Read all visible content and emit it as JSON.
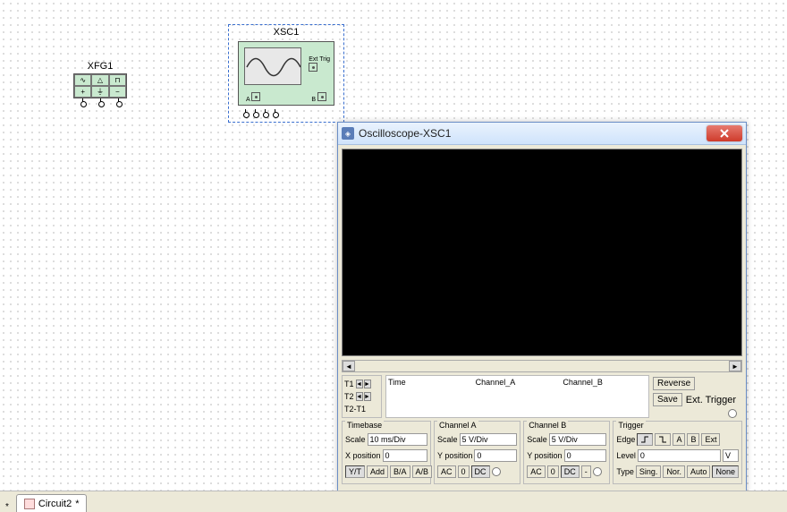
{
  "canvas": {
    "xfg": {
      "label": "XFG1"
    },
    "xsc": {
      "label": "XSC1",
      "ext_trig": "Ext Trig",
      "port_a": "A",
      "port_b": "B"
    }
  },
  "owin": {
    "title": "Oscilloscope-XSC1",
    "cursors": {
      "t1": "T1",
      "t2": "T2",
      "diff": "T2-T1"
    },
    "cols": {
      "time": "Time",
      "cha": "Channel_A",
      "chb": "Channel_B"
    },
    "buttons": {
      "reverse": "Reverse",
      "save": "Save",
      "ext_trigger": "Ext. Trigger"
    },
    "timebase": {
      "title": "Timebase",
      "scale_label": "Scale",
      "scale_value": "10 ms/Div",
      "xpos_label": "X position",
      "xpos_value": "0",
      "btn_yt": "Y/T",
      "btn_add": "Add",
      "btn_ba": "B/A",
      "btn_ab": "A/B"
    },
    "channel_a": {
      "title": "Channel A",
      "scale_label": "Scale",
      "scale_value": "5 V/Div",
      "ypos_label": "Y position",
      "ypos_value": "0",
      "btn_ac": "AC",
      "btn_0": "0",
      "btn_dc": "DC"
    },
    "channel_b": {
      "title": "Channel B",
      "scale_label": "Scale",
      "scale_value": "5 V/Div",
      "ypos_label": "Y position",
      "ypos_value": "0",
      "btn_ac": "AC",
      "btn_0": "0",
      "btn_dc": "DC",
      "btn_minus": "-"
    },
    "trigger": {
      "title": "Trigger",
      "edge_label": "Edge",
      "btn_a": "A",
      "btn_b": "B",
      "btn_ext": "Ext",
      "level_label": "Level",
      "level_value": "0",
      "level_unit": "V",
      "type_label": "Type",
      "btn_sing": "Sing.",
      "btn_nor": "Nor.",
      "btn_auto": "Auto",
      "btn_none": "None"
    }
  },
  "footer": {
    "tab_label": "Circuit2",
    "tab_mark": "*"
  }
}
